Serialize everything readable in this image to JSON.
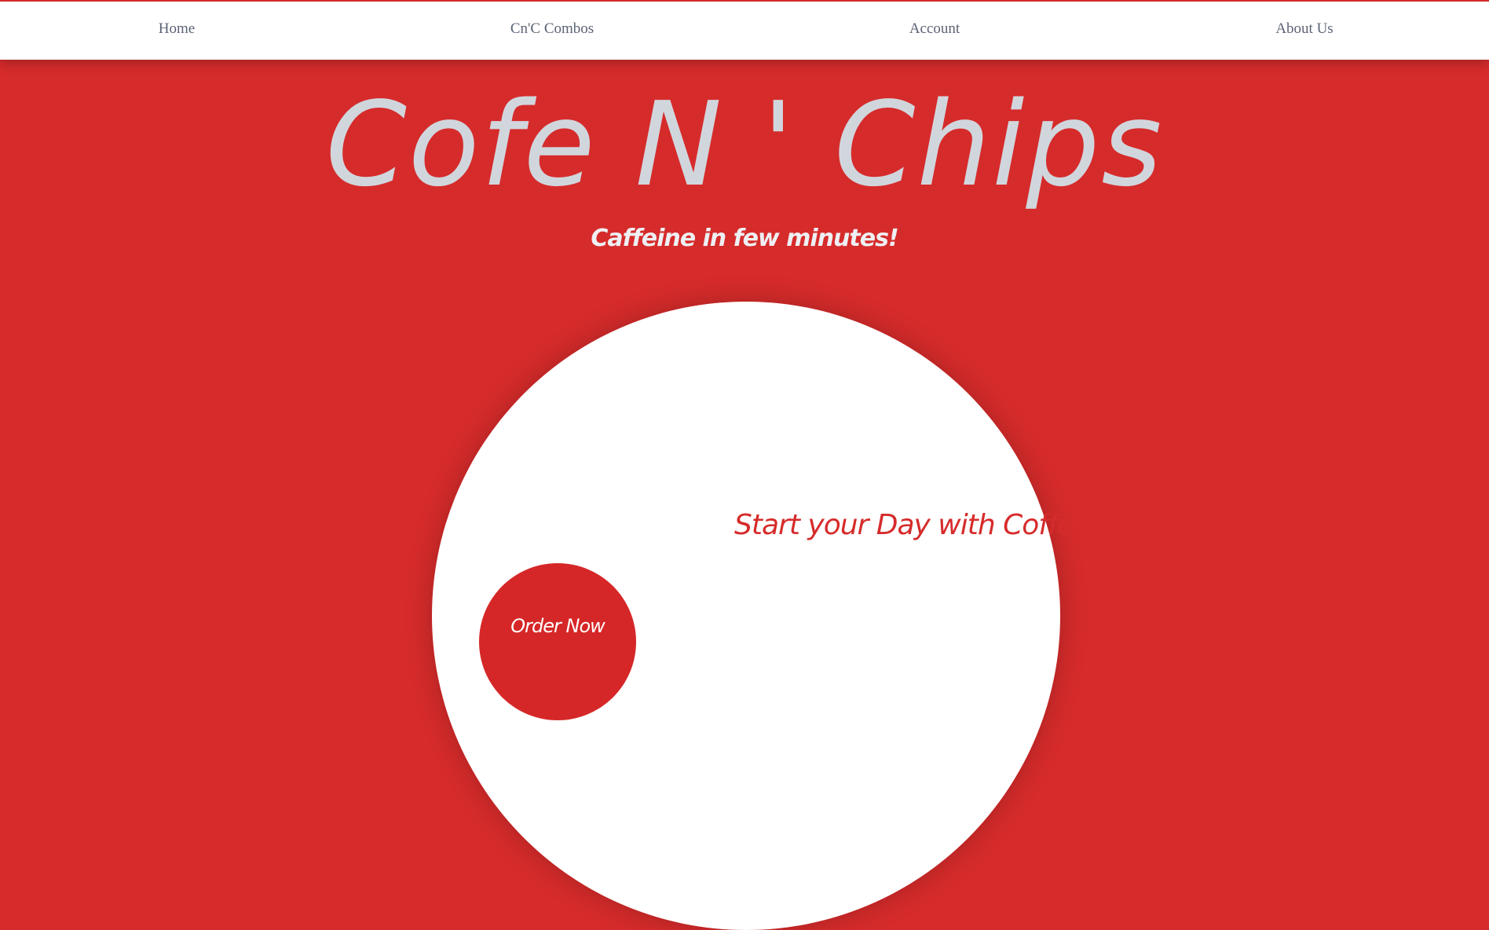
{
  "nav": {
    "items": [
      {
        "label": "Home"
      },
      {
        "label": "Cn'C Combos"
      },
      {
        "label": "Account"
      },
      {
        "label": "About Us"
      }
    ]
  },
  "hero": {
    "title": "Cofe N ' Chips",
    "subtitle": "Caffeine in few minutes!"
  },
  "panel": {
    "tagline": "Start your Day with Coffee",
    "order_label": "Order Now"
  },
  "colors": {
    "brand_red": "#d62b2b",
    "title_gray": "#d1d6dd",
    "nav_text": "#5b6374",
    "white": "#ffffff"
  }
}
